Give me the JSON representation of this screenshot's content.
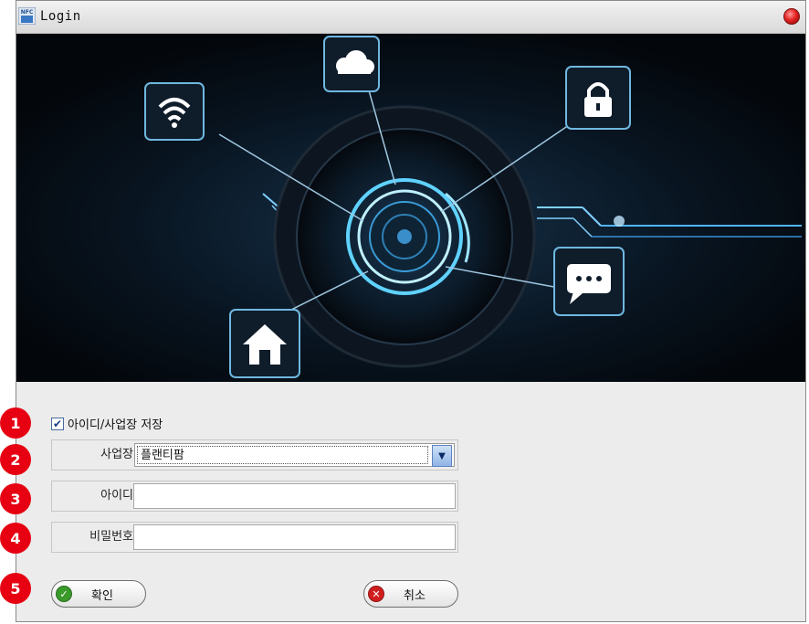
{
  "window": {
    "title": "Login",
    "app_icon_text": "NFC"
  },
  "form": {
    "remember": {
      "label": "아이디/사업장 저장",
      "checked": true,
      "check_glyph": "✔"
    },
    "site": {
      "label": "사업장",
      "value": "플랜티팜",
      "arrow": "▼"
    },
    "user_id": {
      "label": "아이디",
      "value": ""
    },
    "password": {
      "label": "비밀번호",
      "value": ""
    },
    "ok_button": {
      "label": "확인",
      "icon": "check-icon",
      "icon_glyph": "✓",
      "color": "#3a9a2a"
    },
    "cancel_button": {
      "label": "취소",
      "icon": "x-icon",
      "icon_glyph": "✕",
      "color": "#d01e1e"
    }
  },
  "badges": [
    "1",
    "2",
    "3",
    "4",
    "5"
  ],
  "colors": {
    "badge": "#e60012",
    "banner_bg": "#06090f",
    "glow": "#5fd2ff"
  }
}
